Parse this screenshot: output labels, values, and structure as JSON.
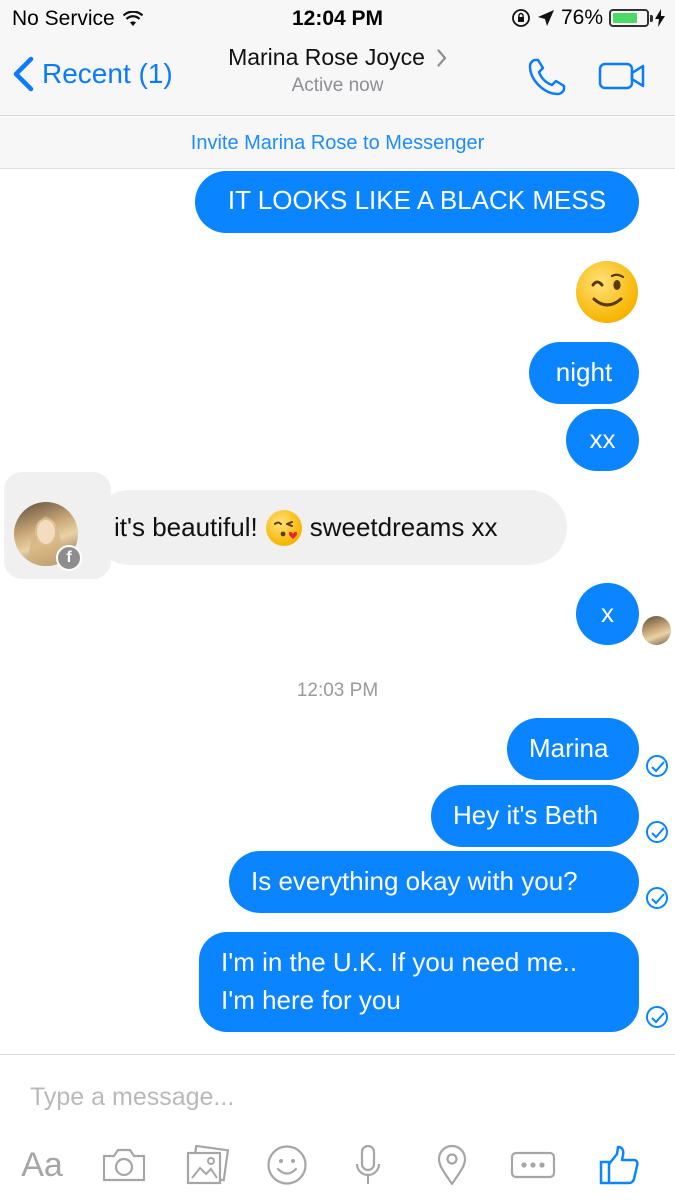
{
  "status_bar": {
    "carrier": "No Service",
    "time": "12:04 PM",
    "battery_percent": "76%",
    "battery_level": 0.76
  },
  "nav": {
    "back_label": "Recent (1)",
    "contact_name": "Marina Rose Joyce",
    "contact_status": "Active now"
  },
  "invite_banner": "Invite Marina Rose to Messenger",
  "messages": {
    "m1": "IT LOOKS LIKE A BLACK MESS",
    "m3": "night",
    "m4": "xx",
    "incoming_before": "it's beautiful!",
    "incoming_after": "sweetdreams xx",
    "m6": "x",
    "timestamp": "12:03 PM",
    "m7": "Marina",
    "m8": "Hey it's Beth",
    "m9": "Is everything okay with you?",
    "m10_line1": "I'm in the U.K. If you need me..",
    "m10_line2": "I'm here for you"
  },
  "composer": {
    "placeholder": "Type a message...",
    "text_tool_label": "Aa"
  },
  "colors": {
    "accent": "#0a84ff",
    "bubble_in": "#f0f0f0",
    "muted": "#8e8e93"
  }
}
